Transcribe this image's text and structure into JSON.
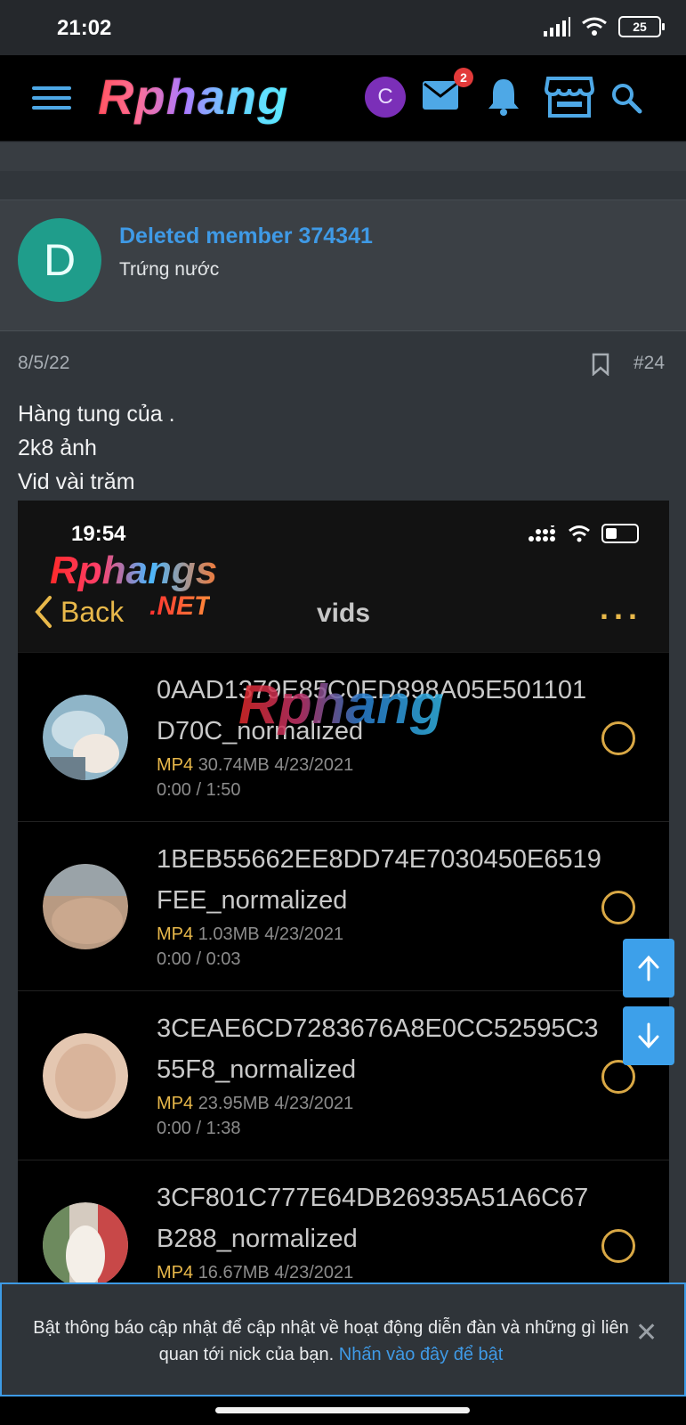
{
  "status_bar": {
    "time": "21:02",
    "battery": "25"
  },
  "navbar": {
    "logo": "Rphang",
    "avatar_letter": "C",
    "mail_badge": "2",
    "colors": {
      "accent": "#4ea8e6",
      "badge": "#e23a3a",
      "avatar": "#7b2fb8"
    }
  },
  "post": {
    "author": {
      "initial": "D",
      "name": "Deleted member 374341",
      "title": "Trứng nước",
      "avatar_color": "#1f9d8b"
    },
    "date": "8/5/22",
    "number": "#24",
    "lines": [
      "Hàng tung của .",
      "2k8 ảnh",
      "Vid vài trăm"
    ]
  },
  "embedded_screenshot": {
    "time": "19:54",
    "watermark": "Rphangs",
    "watermark_suffix": ".NET",
    "back_label": "Back",
    "title": "vids",
    "more": "...",
    "center_watermark": "Rphang",
    "videos": [
      {
        "name": "0AAD1379E85C0ED898A05E501101D70C_normalized",
        "format": "MP4",
        "size": "30.74MB",
        "date": "4/23/2021",
        "duration": "0:00 / 1:50"
      },
      {
        "name": "1BEB55662EE8DD74E7030450E6519FEE_normalized",
        "format": "MP4",
        "size": "1.03MB",
        "date": "4/23/2021",
        "duration": "0:00 / 0:03"
      },
      {
        "name": "3CEAE6CD7283676A8E0CC52595C355F8_normalized",
        "format": "MP4",
        "size": "23.95MB",
        "date": "4/23/2021",
        "duration": "0:00 / 1:38"
      },
      {
        "name": "3CF801C777E64DB26935A51A6C67B288_normalized",
        "format": "MP4",
        "size": "16.67MB",
        "date": "4/23/2021",
        "duration": ""
      }
    ]
  },
  "notification": {
    "text": "Bật thông báo cập nhật để cập nhật về hoạt động diễn đàn và những gì liên quan tới nick của bạn.",
    "link": "Nhấn vào đây để bật"
  }
}
